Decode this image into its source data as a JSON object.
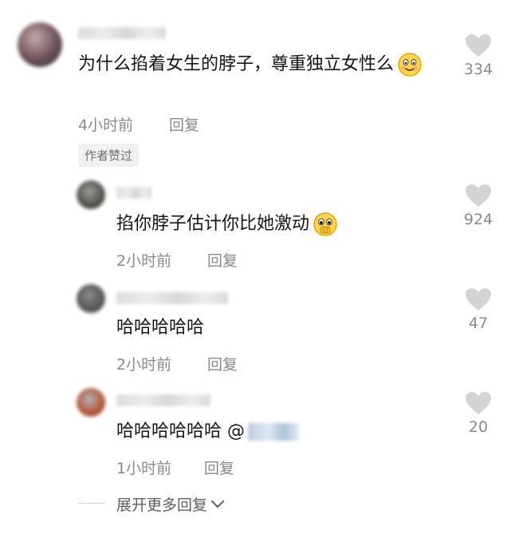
{
  "comments": [
    {
      "text": "为什么掐着女生的脖子，尊重独立女性么",
      "time": "4小时前",
      "reply": "回复",
      "likes": "334",
      "badge": "作者赞过"
    },
    {
      "text": "掐你脖子估计你比她激动",
      "time": "2小时前",
      "reply": "回复",
      "likes": "924"
    },
    {
      "text": "哈哈哈哈哈",
      "time": "2小时前",
      "reply": "回复",
      "likes": "47"
    },
    {
      "text": "哈哈哈哈哈哈 @",
      "time": "1小时前",
      "reply": "回复",
      "likes": "20"
    }
  ],
  "expand_label": "展开更多回复",
  "icons": {
    "like": "heart-icon",
    "expand": "chevron-down-icon",
    "emoji_1": "smile-emoji-icon",
    "emoji_2": "pleading-emoji-icon"
  },
  "colors": {
    "text": "#161616",
    "meta": "#8a8a8a",
    "heart": "#d4d4d4",
    "badge_bg": "#f1f1f1",
    "background": "#ffffff"
  }
}
